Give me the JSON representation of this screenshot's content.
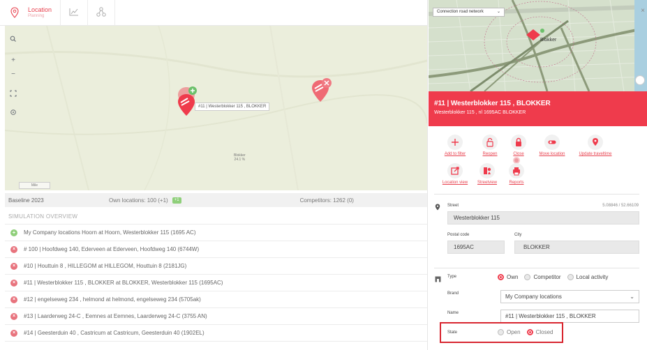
{
  "nav": {
    "location_title": "Location",
    "location_sub": "Planning"
  },
  "map": {
    "scale_label": "Mile",
    "town_name": "Blokker",
    "town_value": "24.1 %",
    "tooltip": "#11 | Westerblokker 115 , BLOKKER",
    "controls": [
      "search-icon",
      "zoom-in-icon",
      "zoom-out-icon",
      "fullscreen-icon",
      "locate-icon"
    ]
  },
  "stats": {
    "baseline": "Baseline 2023",
    "own": "Own locations: 100 (+1)",
    "own_badge": "+1",
    "competitors": "Competitors: 1262 (0)"
  },
  "simulation": {
    "header": "SIMULATION OVERVIEW",
    "rows": [
      {
        "type": "add",
        "text": "My Company locations Hoorn at Hoorn, Westerblokker 115 (1695 AC)"
      },
      {
        "type": "remove",
        "text": "# 100 | Hoofdweg 140, Ederveen at Ederveen, Hoofdweg 140 (6744W)"
      },
      {
        "type": "remove",
        "text": "#10 | Houttuin 8 , HILLEGOM at HILLEGOM, Houttuin 8 (2181JG)"
      },
      {
        "type": "remove",
        "text": "#11 | Westerblokker 115 , BLOKKER at BLOKKER, Westerblokker 115 (1695AC)"
      },
      {
        "type": "remove",
        "text": "#12 | engelseweg 234 , helmond at helmond, engelseweg 234 (5705ak)"
      },
      {
        "type": "remove",
        "text": "#13 | Laarderweg 24-C , Eemnes at Eemnes, Laarderweg 24-C (3755 AN)"
      },
      {
        "type": "remove",
        "text": "#14 | Geesterduin 40 , Castricum at Castricum, Geesterduin 40 (1902EL)"
      }
    ]
  },
  "panel": {
    "layer_select": "Connection road network",
    "map_town_label": "Blokker",
    "title": "#11 | Westerblokker 115 , BLOKKER",
    "subtitle": "Westerblokker 115 , nl 1695AC BLOKKER",
    "actions": [
      {
        "label": "Add to filter",
        "icon": "plus-icon"
      },
      {
        "label": "Reopen",
        "icon": "unlock-icon"
      },
      {
        "label": "Close",
        "icon": "lock-icon"
      },
      {
        "label": "Move location",
        "icon": "toggle-icon"
      },
      {
        "label": "Update traveltime",
        "icon": "pin-icon"
      },
      {
        "label": "Location view",
        "icon": "external-link-icon"
      },
      {
        "label": "Streetview",
        "icon": "pegman-icon"
      },
      {
        "label": "Reports",
        "icon": "printer-icon"
      }
    ],
    "street_label": "Street",
    "coords": "5.08846 / 52.66109",
    "street_value": "Westerblokker 115",
    "postal_label": "Postal code",
    "postal_value": "1695AC",
    "city_label": "City",
    "city_value": "BLOKKER",
    "type_label": "Type",
    "type_options": [
      "Own",
      "Competitor",
      "Local activity"
    ],
    "type_selected": "Own",
    "brand_label": "Brand",
    "brand_value": "My Company locations",
    "name_label": "Name",
    "name_value": "#11 | Westerblokker 115 , BLOKKER",
    "state_label": "State",
    "state_options": [
      "Open",
      "Closed"
    ],
    "state_selected": "Closed"
  },
  "colors": {
    "accent": "#ef3b4c",
    "add_green": "#8fcf7a",
    "remove_red": "#e8737d",
    "map_bg": "#ebeedc"
  }
}
